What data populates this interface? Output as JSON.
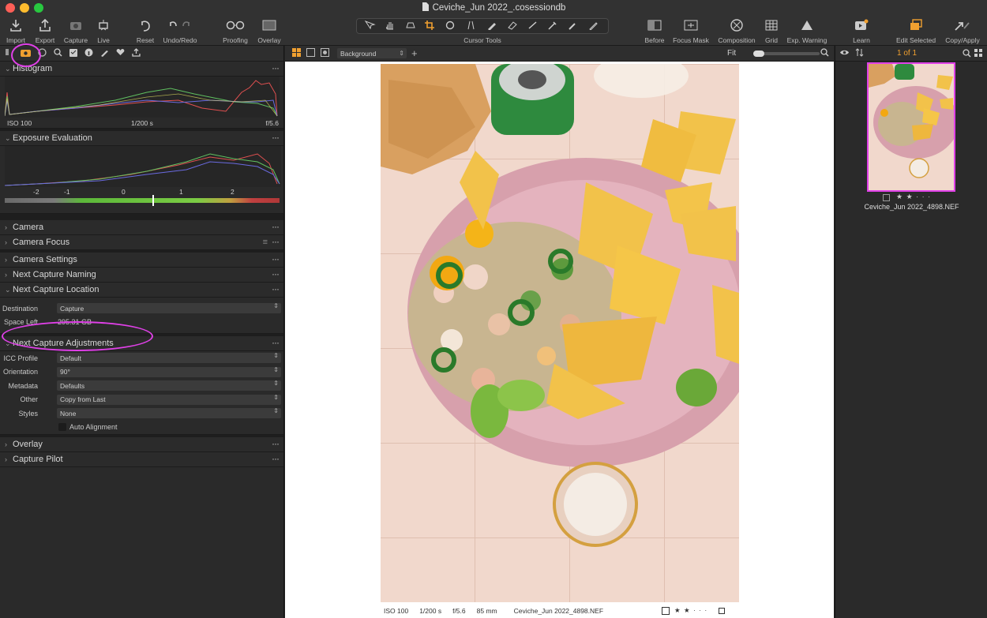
{
  "window": {
    "title": "Ceviche_Jun 2022_.cosessiondb"
  },
  "toolbar": {
    "import": "Import",
    "export": "Export",
    "capture": "Capture",
    "live": "Live",
    "reset": "Reset",
    "undo_redo": "Undo/Redo",
    "proofing": "Proofing",
    "overlay": "Overlay",
    "cursor_tools": "Cursor Tools",
    "before": "Before",
    "focus_mask": "Focus Mask",
    "composition": "Composition",
    "grid": "Grid",
    "exp_warning": "Exp. Warning",
    "learn": "Learn",
    "edit_selected": "Edit Selected",
    "copy_apply": "Copy/Apply"
  },
  "histogram": {
    "title": "Histogram",
    "iso": "ISO 100",
    "shutter": "1/200 s",
    "aperture": "f/5.6"
  },
  "exposure": {
    "title": "Exposure Evaluation",
    "ticks": [
      "-2",
      "-1",
      "0",
      "1",
      "2"
    ]
  },
  "sections": {
    "camera": "Camera",
    "camera_focus": "Camera Focus",
    "camera_settings": "Camera Settings",
    "next_capture_naming": "Next Capture Naming",
    "next_capture_location": "Next Capture Location",
    "next_capture_adjustments": "Next Capture Adjustments",
    "overlay": "Overlay",
    "capture_pilot": "Capture Pilot"
  },
  "location": {
    "destination_label": "Destination",
    "destination_value": "Capture",
    "space_left_label": "Space Left",
    "space_left_value": "295.31 GB"
  },
  "adjustments": {
    "icc_label": "ICC Profile",
    "icc_value": "Default",
    "orientation_label": "Orientation",
    "orientation_value": "90°",
    "metadata_label": "Metadata",
    "metadata_value": "Defaults",
    "other_label": "Other",
    "other_value": "Copy from Last",
    "styles_label": "Styles",
    "styles_value": "None",
    "auto_alignment": "Auto Alignment"
  },
  "viewer": {
    "background_select": "Background",
    "fit": "Fit"
  },
  "photo_meta": {
    "iso": "ISO 100",
    "shutter": "1/200 s",
    "aperture": "f/5.6",
    "focal": "85 mm",
    "filename": "Ceviche_Jun 2022_4898.NEF",
    "rating": "★ ★ · · ·"
  },
  "browser": {
    "count": "1 of 1",
    "thumb_name": "Ceviche_Jun 2022_4898.NEF",
    "rating": "★ ★ · · ·"
  },
  "colors": {
    "accent": "#f0a030",
    "highlight": "#e040e8",
    "panel": "#2a2a2a"
  }
}
